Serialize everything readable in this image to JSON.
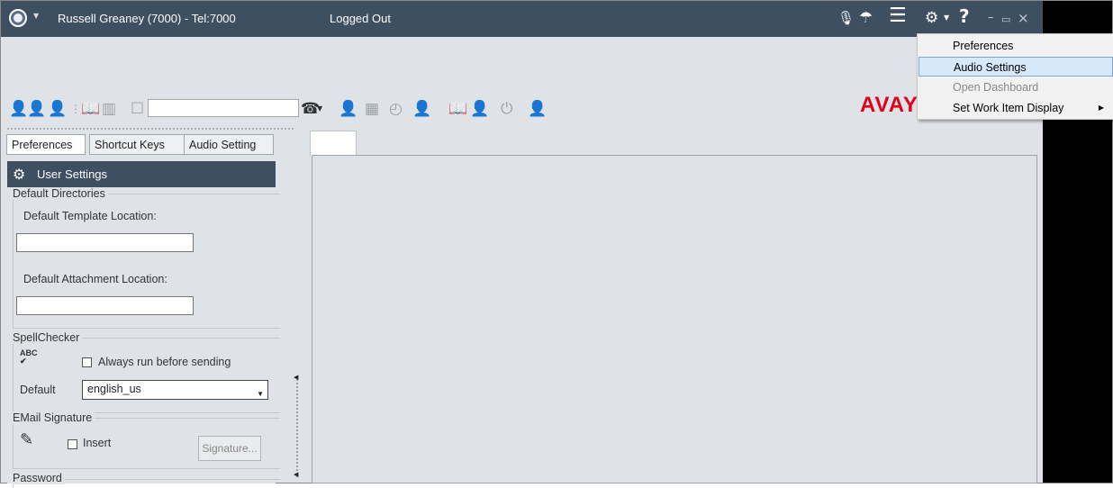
{
  "titlebar": {
    "user": "Russell Greaney (7000) - Tel:7000",
    "status": "Logged Out",
    "help": "?",
    "minimize": "–",
    "maximize": "▭",
    "close": "×"
  },
  "brand": {
    "logo": "AVAY",
    "color": "#e2001a"
  },
  "tabs": [
    {
      "label": "Preferences"
    },
    {
      "label": "Shortcut Keys"
    },
    {
      "label": "Audio Setting"
    }
  ],
  "panel": {
    "header": "User Settings",
    "default_directories": {
      "title": "Default Directories",
      "template_label": "Default Template Location:",
      "template_value": "",
      "attachment_label": "Default Attachment Location:",
      "attachment_value": ""
    },
    "spellchecker": {
      "title": "SpellChecker",
      "always_run_label": "Always run before sending",
      "default_label": "Default",
      "default_value": "english_us"
    },
    "email_signature": {
      "title": "EMail Signature",
      "insert_label": "Insert",
      "signature_button": "Signature..."
    },
    "password": {
      "title": "Password"
    }
  },
  "menu": {
    "items": [
      {
        "label": "Preferences",
        "state": "normal"
      },
      {
        "label": "Audio Settings",
        "state": "highlighted"
      },
      {
        "label": "Open Dashboard",
        "state": "disabled"
      },
      {
        "label": "Set Work Item Display",
        "state": "submenu"
      }
    ]
  },
  "colors": {
    "titlebar": "#3e4f62",
    "workarea": "#dfe3e7",
    "menu_highlight": "#d6e8fa"
  }
}
